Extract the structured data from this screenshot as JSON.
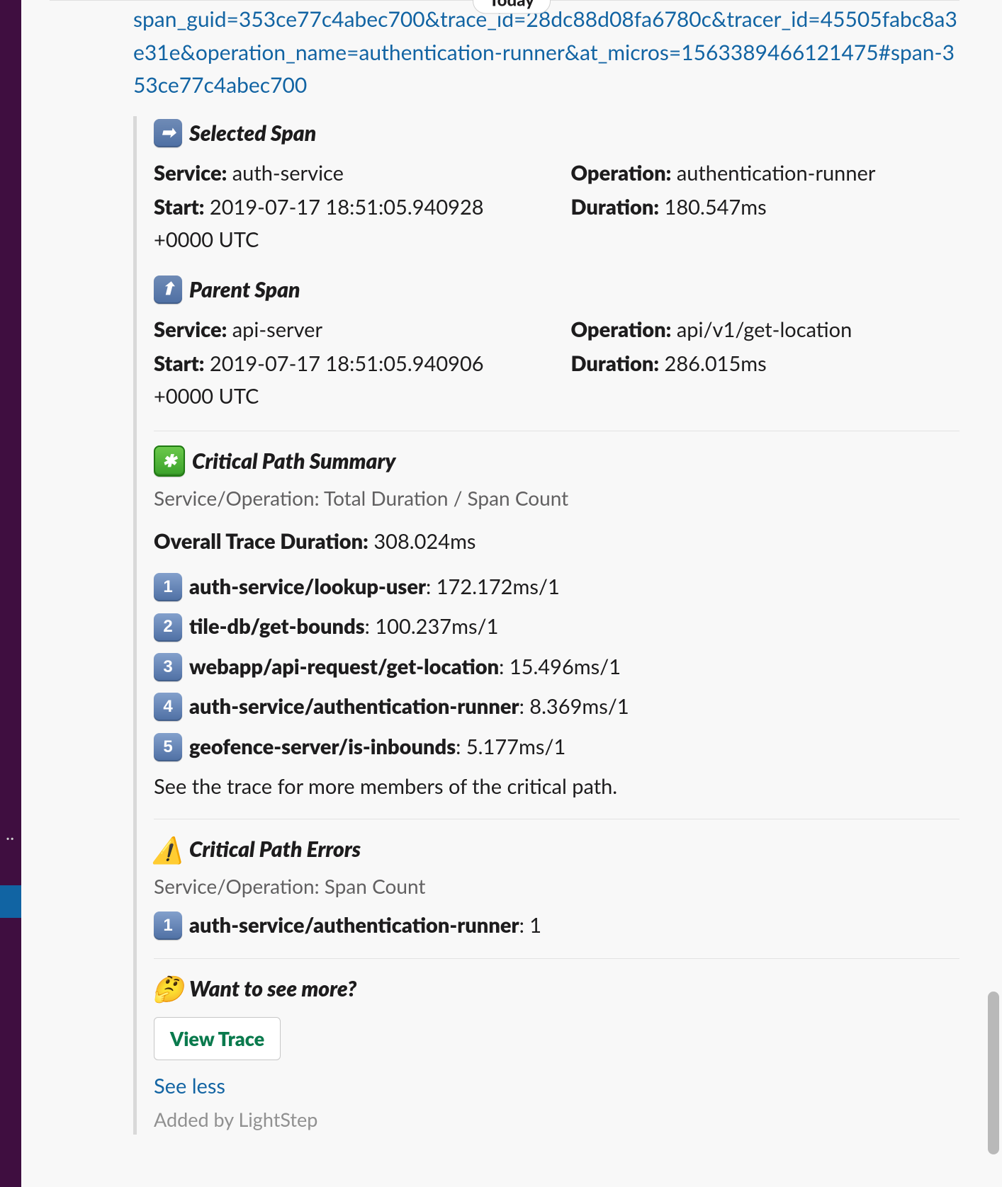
{
  "date_pill": "Today",
  "url": "span_guid=353ce77c4abec700&trace_id=28dc88d08fa6780c&tracer_id=45505fabc8a3e31e&operation_name=authentication-runner&at_micros=1563389466121475#span-353ce77c4abec700",
  "selected": {
    "title": "Selected Span",
    "service_label": "Service:",
    "service_value": "auth-service",
    "operation_label": "Operation:",
    "operation_value": "authentication-runner",
    "start_label": "Start:",
    "start_value": "2019-07-17 18:51:05.940928 +0000 UTC",
    "duration_label": "Duration:",
    "duration_value": "180.547ms"
  },
  "parent": {
    "title": "Parent Span",
    "service_label": "Service:",
    "service_value": "api-server",
    "operation_label": "Operation:",
    "operation_value": "api/v1/get-location",
    "start_label": "Start:",
    "start_value": "2019-07-17 18:51:05.940906 +0000 UTC",
    "duration_label": "Duration:",
    "duration_value": "286.015ms"
  },
  "cps": {
    "title": "Critical Path Summary",
    "meta": "Service/Operation: Total Duration / Span Count",
    "overall_label": "Overall Trace Duration:",
    "overall_value": "308.024ms",
    "rows": [
      {
        "num": "1",
        "name": "auth-service/lookup-user",
        "val": "172.172ms/1"
      },
      {
        "num": "2",
        "name": "tile-db/get-bounds",
        "val": "100.237ms/1"
      },
      {
        "num": "3",
        "name": "webapp/api-request/get-location",
        "val": "15.496ms/1"
      },
      {
        "num": "4",
        "name": "auth-service/authentication-runner",
        "val": "8.369ms/1"
      },
      {
        "num": "5",
        "name": "geofence-server/is-inbounds",
        "val": "5.177ms/1"
      }
    ],
    "more_note": "See the trace for more members of the critical path."
  },
  "cpe": {
    "title": "Critical Path Errors",
    "meta": "Service/Operation: Span Count",
    "rows": [
      {
        "num": "1",
        "name": "auth-service/authentication-runner",
        "val": "1"
      }
    ]
  },
  "more": {
    "title": "Want to see more?",
    "button": "View Trace"
  },
  "footer": {
    "see_less": "See less",
    "added_by": "Added by LightStep"
  }
}
